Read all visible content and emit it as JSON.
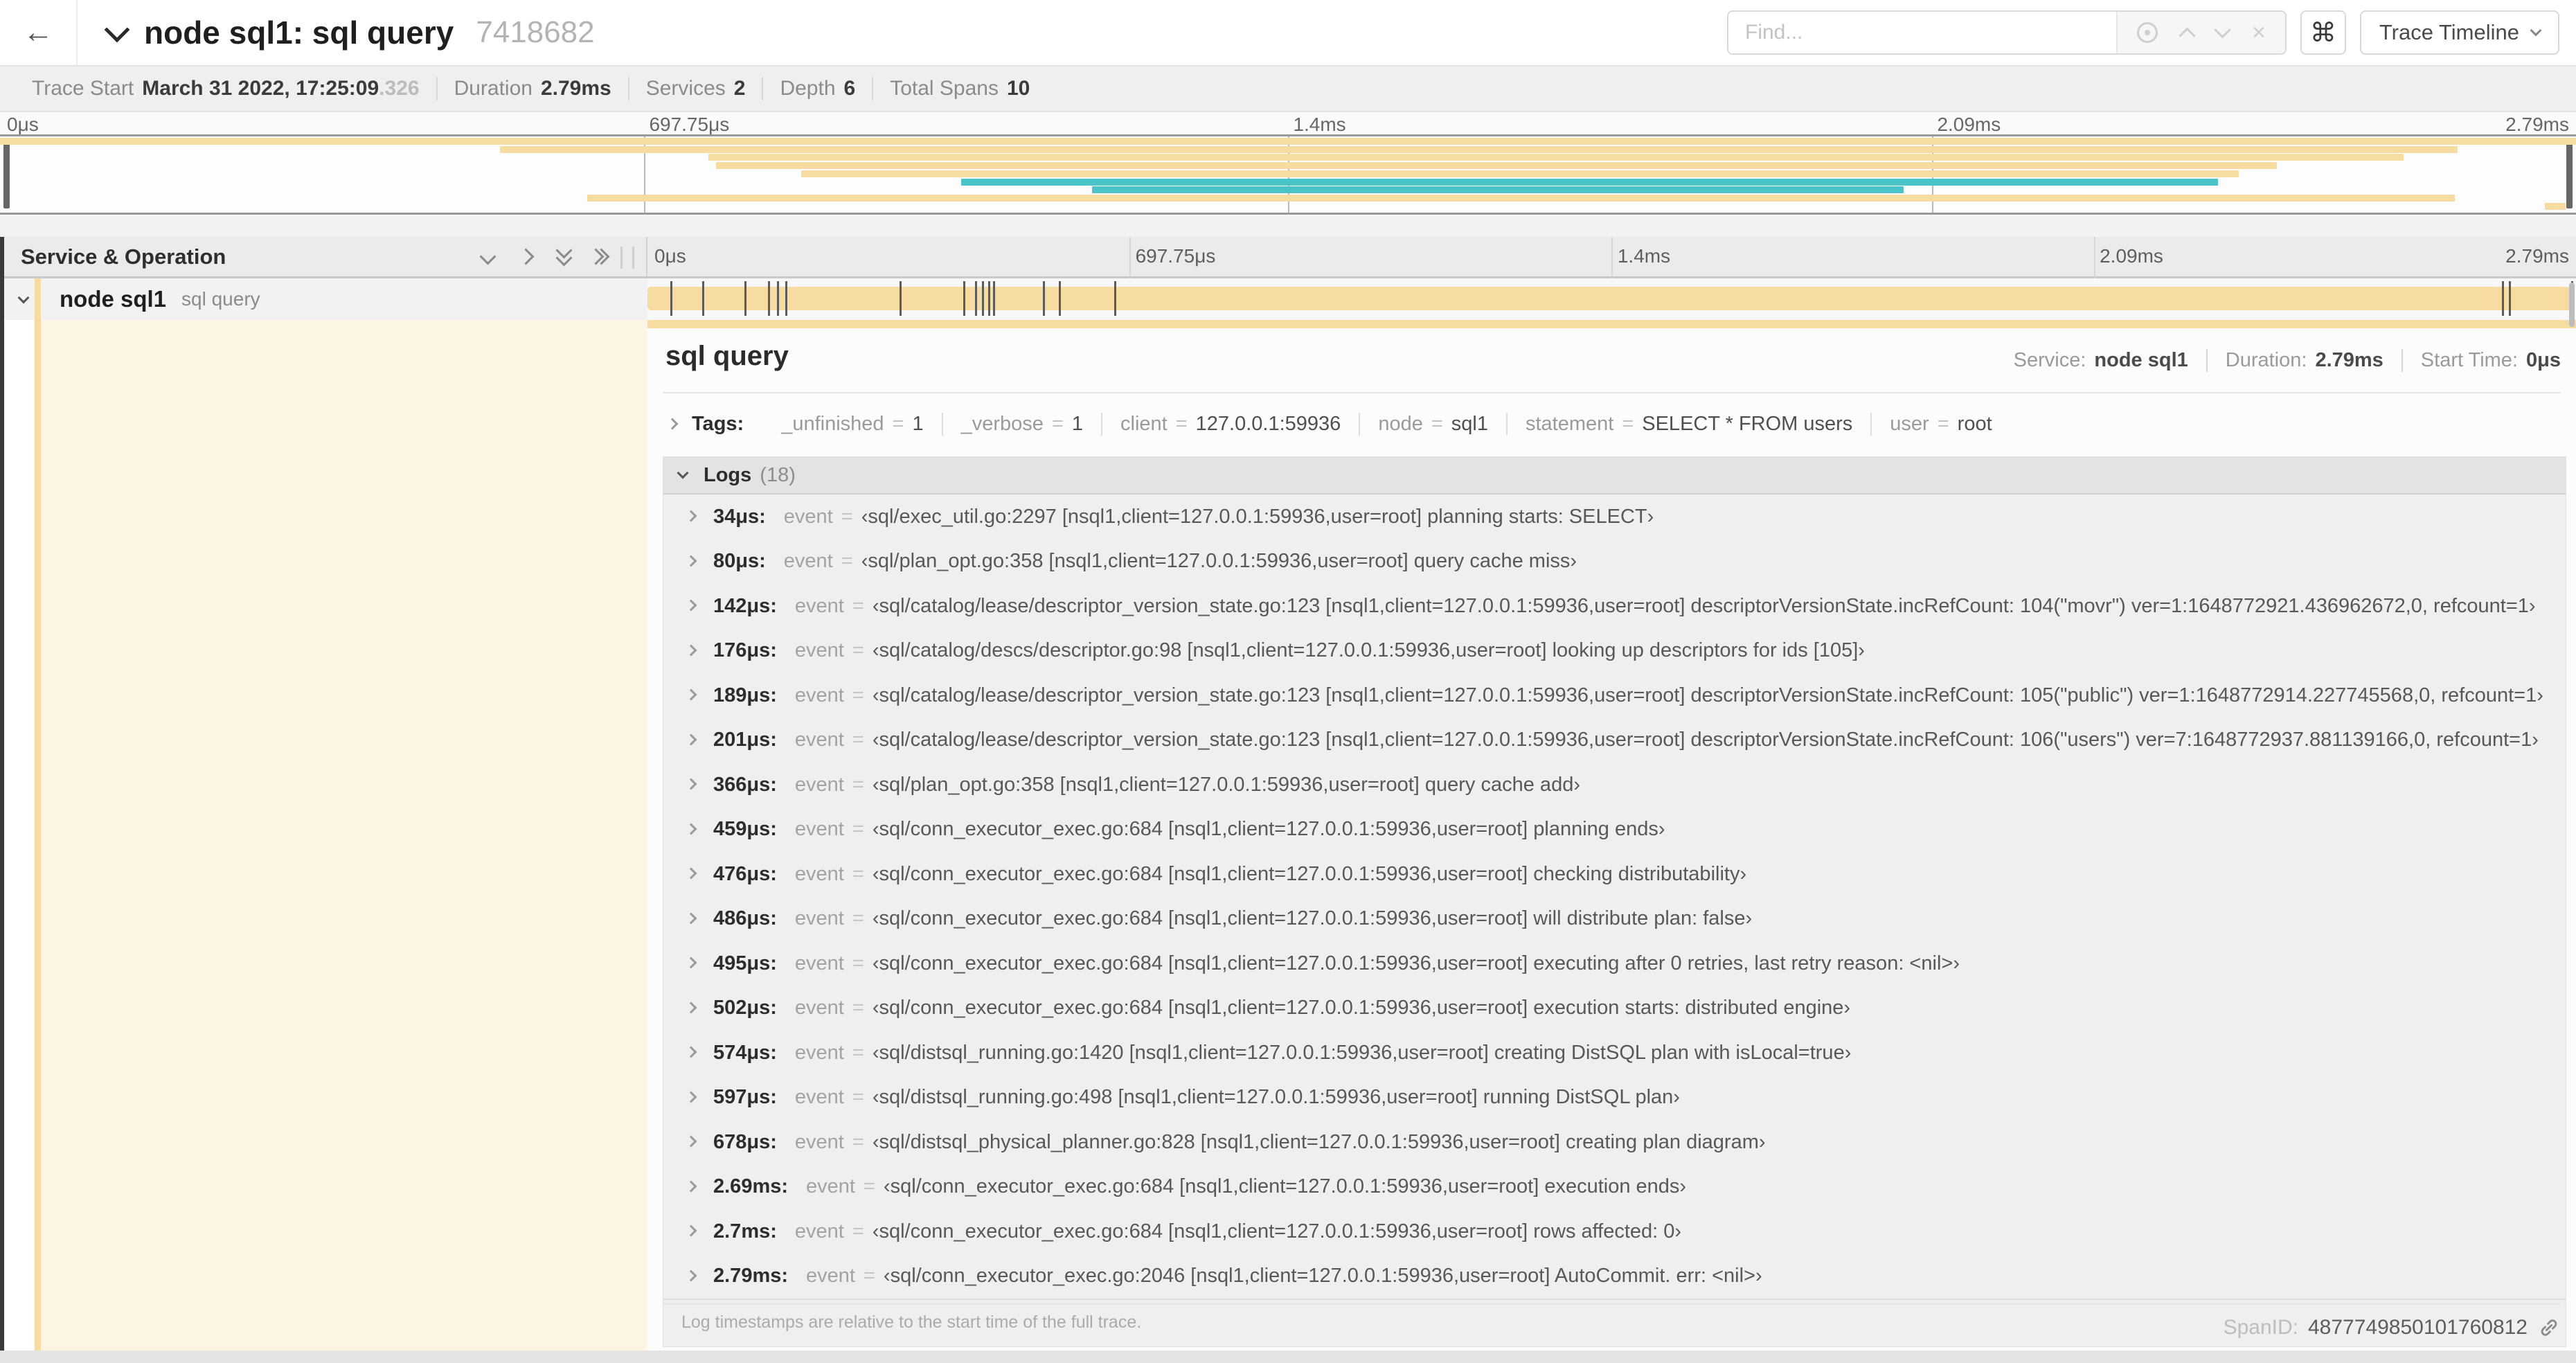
{
  "symbols": {
    "eq": "="
  },
  "colors": {
    "tan": "#f7dca2",
    "teal": "#4ac3c9",
    "cream": "#fdf5e4"
  },
  "header": {
    "back_arrow": "←",
    "title": "node sql1: sql query",
    "trace_id": "7418682",
    "find_placeholder": "Find...",
    "clear_icon": "×",
    "shortcut_button": "⌘",
    "view_select": "Trace Timeline"
  },
  "summary": {
    "items": [
      {
        "label": "Trace Start",
        "value": "March 31 2022, 17:25:09",
        "muted_suffix": ".326"
      },
      {
        "label": "Duration",
        "value": "2.79ms"
      },
      {
        "label": "Services",
        "value": "2"
      },
      {
        "label": "Depth",
        "value": "6"
      },
      {
        "label": "Total Spans",
        "value": "10"
      }
    ]
  },
  "minimap": {
    "ticks": [
      "0μs",
      "697.75μs",
      "1.4ms",
      "2.09ms",
      "2.79ms"
    ],
    "spans": [
      {
        "s": 0.0,
        "e": 1.0,
        "color": "tan"
      },
      {
        "s": 0.194,
        "e": 0.954,
        "color": "tan"
      },
      {
        "s": 0.275,
        "e": 0.933,
        "color": "tan"
      },
      {
        "s": 0.278,
        "e": 0.884,
        "color": "tan"
      },
      {
        "s": 0.311,
        "e": 0.869,
        "color": "tan"
      },
      {
        "s": 0.373,
        "e": 0.861,
        "color": "teal"
      },
      {
        "s": 0.424,
        "e": 0.739,
        "color": "teal"
      },
      {
        "s": 0.228,
        "e": 0.953,
        "color": "tan"
      },
      {
        "s": 0.988,
        "e": 0.996,
        "color": "tan"
      }
    ]
  },
  "timeline_header": {
    "label": "Service & Operation",
    "ticks": [
      "0μs",
      "697.75μs",
      "1.4ms",
      "2.09ms",
      "2.79ms"
    ]
  },
  "span_row": {
    "service": "node sql1",
    "operation": "sql query",
    "duration_us": 2790,
    "marker_times_us": [
      34,
      80,
      142,
      176,
      189,
      201,
      366,
      459,
      476,
      486,
      495,
      502,
      574,
      597,
      678,
      2690,
      2700,
      2790
    ]
  },
  "detail": {
    "title": "sql query",
    "meta": [
      {
        "label": "Service:",
        "value": "node sql1"
      },
      {
        "label": "Duration:",
        "value": "2.79ms"
      },
      {
        "label": "Start Time:",
        "value": "0μs"
      }
    ],
    "tags_label": "Tags:",
    "tags": [
      {
        "key": "_unfinished",
        "value": "1"
      },
      {
        "key": "_verbose",
        "value": "1"
      },
      {
        "key": "client",
        "value": "127.0.0.1:59936"
      },
      {
        "key": "node",
        "value": "sql1"
      },
      {
        "key": "statement",
        "value": "SELECT * FROM users"
      },
      {
        "key": "user",
        "value": "root"
      }
    ],
    "logs_label": "Logs",
    "logs_count": "(18)",
    "logs": [
      {
        "time": "34μs:",
        "key": "event",
        "value": "‹sql/exec_util.go:2297 [nsql1,client=127.0.0.1:59936,user=root] planning starts: SELECT›"
      },
      {
        "time": "80μs:",
        "key": "event",
        "value": "‹sql/plan_opt.go:358 [nsql1,client=127.0.0.1:59936,user=root] query cache miss›"
      },
      {
        "time": "142μs:",
        "key": "event",
        "value": "‹sql/catalog/lease/descriptor_version_state.go:123 [nsql1,client=127.0.0.1:59936,user=root] descriptorVersionState.incRefCount: 104(\"movr\") ver=1:1648772921.436962672,0, refcount=1›"
      },
      {
        "time": "176μs:",
        "key": "event",
        "value": "‹sql/catalog/descs/descriptor.go:98 [nsql1,client=127.0.0.1:59936,user=root] looking up descriptors for ids [105]›"
      },
      {
        "time": "189μs:",
        "key": "event",
        "value": "‹sql/catalog/lease/descriptor_version_state.go:123 [nsql1,client=127.0.0.1:59936,user=root] descriptorVersionState.incRefCount: 105(\"public\") ver=1:1648772914.227745568,0, refcount=1›"
      },
      {
        "time": "201μs:",
        "key": "event",
        "value": "‹sql/catalog/lease/descriptor_version_state.go:123 [nsql1,client=127.0.0.1:59936,user=root] descriptorVersionState.incRefCount: 106(\"users\") ver=7:1648772937.881139166,0, refcount=1›"
      },
      {
        "time": "366μs:",
        "key": "event",
        "value": "‹sql/plan_opt.go:358 [nsql1,client=127.0.0.1:59936,user=root] query cache add›"
      },
      {
        "time": "459μs:",
        "key": "event",
        "value": "‹sql/conn_executor_exec.go:684 [nsql1,client=127.0.0.1:59936,user=root] planning ends›"
      },
      {
        "time": "476μs:",
        "key": "event",
        "value": "‹sql/conn_executor_exec.go:684 [nsql1,client=127.0.0.1:59936,user=root] checking distributability›"
      },
      {
        "time": "486μs:",
        "key": "event",
        "value": "‹sql/conn_executor_exec.go:684 [nsql1,client=127.0.0.1:59936,user=root] will distribute plan: false›"
      },
      {
        "time": "495μs:",
        "key": "event",
        "value": "‹sql/conn_executor_exec.go:684 [nsql1,client=127.0.0.1:59936,user=root] executing after 0 retries, last retry reason: <nil>›"
      },
      {
        "time": "502μs:",
        "key": "event",
        "value": "‹sql/conn_executor_exec.go:684 [nsql1,client=127.0.0.1:59936,user=root] execution starts: distributed engine›"
      },
      {
        "time": "574μs:",
        "key": "event",
        "value": "‹sql/distsql_running.go:1420 [nsql1,client=127.0.0.1:59936,user=root] creating DistSQL plan with isLocal=true›"
      },
      {
        "time": "597μs:",
        "key": "event",
        "value": "‹sql/distsql_running.go:498 [nsql1,client=127.0.0.1:59936,user=root] running DistSQL plan›"
      },
      {
        "time": "678μs:",
        "key": "event",
        "value": "‹sql/distsql_physical_planner.go:828 [nsql1,client=127.0.0.1:59936,user=root] creating plan diagram›"
      },
      {
        "time": "2.69ms:",
        "key": "event",
        "value": "‹sql/conn_executor_exec.go:684 [nsql1,client=127.0.0.1:59936,user=root] execution ends›"
      },
      {
        "time": "2.7ms:",
        "key": "event",
        "value": "‹sql/conn_executor_exec.go:684 [nsql1,client=127.0.0.1:59936,user=root] rows affected: 0›"
      },
      {
        "time": "2.79ms:",
        "key": "event",
        "value": "‹sql/conn_executor_exec.go:2046 [nsql1,client=127.0.0.1:59936,user=root] AutoCommit. err: <nil>›"
      }
    ],
    "note": "Log timestamps are relative to the start time of the full trace.",
    "span_id_label": "SpanID:",
    "span_id": "4877749850101760812"
  }
}
